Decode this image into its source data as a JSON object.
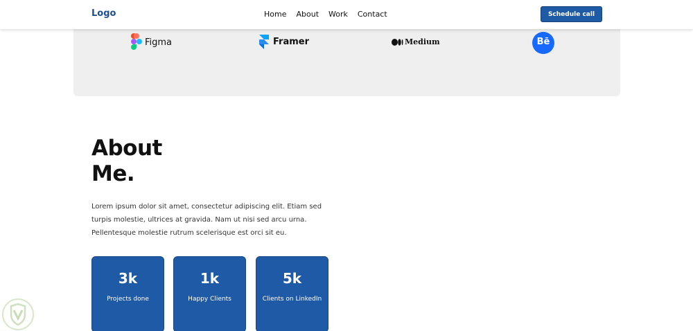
{
  "nav": {
    "logo": "Logo",
    "links": [
      "Home",
      "About",
      "Work",
      "Contact"
    ],
    "cta": "Schedule call"
  },
  "brands": [
    {
      "name": "Figma",
      "icon": "figma-icon"
    },
    {
      "name": "Framer",
      "icon": "framer-icon"
    },
    {
      "name": "Medium",
      "icon": "medium-icon"
    },
    {
      "name": "Bē",
      "icon": "behance-icon"
    }
  ],
  "about": {
    "title_line1": "About",
    "title_line2": "Me.",
    "text": "Lorem ipsum dolor sit amet, consectetur adipiscing elit. Etiam sed turpis molestie, ultrices at gravida. Nam ut nisi sed arcu urna. Pellentesque molestie rutrum scelerisque est orci sit eu."
  },
  "stats": [
    {
      "value": "3k",
      "label": "Projects done"
    },
    {
      "value": "1k",
      "label": "Happy Clients"
    },
    {
      "value": "5k",
      "label": "Clients on LinkedIn"
    }
  ],
  "colors": {
    "primary": "#1f5aa6",
    "logo": "#1e4f94",
    "band": "#efefef",
    "behance": "#1769ff"
  }
}
